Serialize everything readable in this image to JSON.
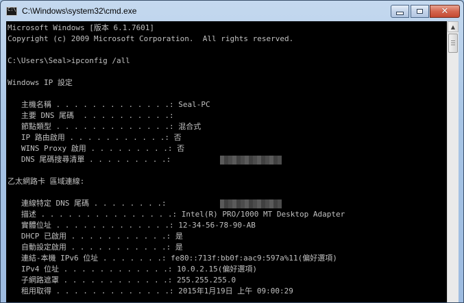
{
  "window": {
    "title": "C:\\Windows\\system32\\cmd.exe",
    "close_glyph": "✕"
  },
  "scrollbar": {
    "up_glyph": "▲"
  },
  "console": {
    "lines": [
      "Microsoft Windows [版本 6.1.7601]",
      "Copyright (c) 2009 Microsoft Corporation.  All rights reserved.",
      "",
      "C:\\Users\\Seal>ipconfig /all",
      "",
      "Windows IP 設定",
      "",
      "   主機名稱 . . . . . . . . . . . . .: Seal-PC",
      "   主要 DNS 尾碼  . . . . . . . . . .:",
      "   節點類型 . . . . . . . . . . . . .: 混合式",
      "   IP 路由啟用 . . . . . . . . . . .: 否",
      "   WINS Proxy 啟用 . . . . . . . . .: 否",
      "   DNS 尾碼搜尋清單 . . . . . . . . .:",
      "",
      "乙太網路卡 區域連線:",
      "",
      "   連線特定 DNS 尾碼 . . . . . . . .:",
      "   描述 . . . . . . . . . . . . . . .: Intel(R) PRO/1000 MT Desktop Adapter",
      "   實體位址 . . . . . . . . . . . . .: 12-34-56-78-90-AB",
      "   DHCP 已啟用 . . . . . . . . . . .: 是",
      "   自動設定啟用 . . . . . . . . . . .: 是",
      "   連結-本機 IPv6 位址 . . . . . . .: fe80::713f:bb0f:aac9:597a%11(偏好選項)",
      "   IPv4 位址 . . . . . . . . . . . .: 10.0.2.15(偏好選項)",
      "   子網路遮罩 . . . . . . . . . . . .: 255.255.255.0",
      "   租用取得 . . . . . . . . . . . . .: 2015年1月19日 上午 09:00:29"
    ]
  }
}
